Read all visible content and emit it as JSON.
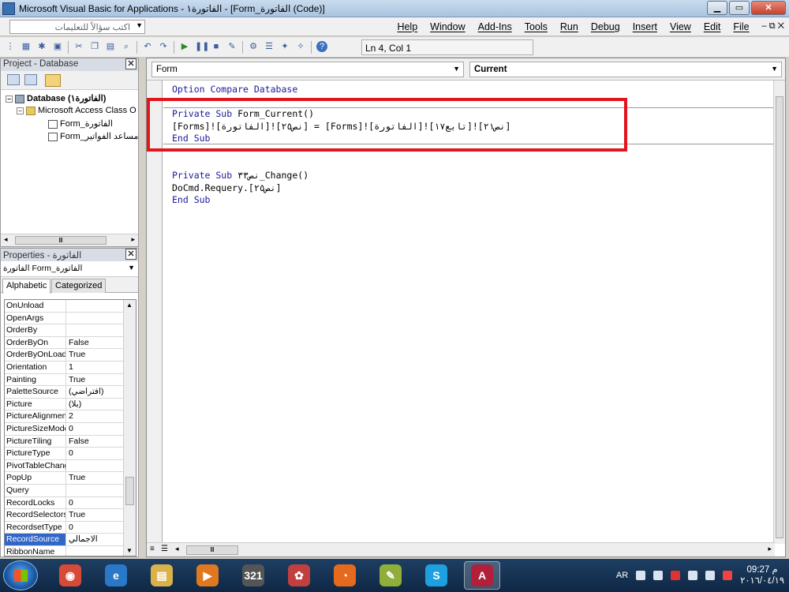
{
  "window": {
    "title": "Microsoft Visual Basic for Applications - الفاتورة١ - [Form_الفاتورة (Code)]",
    "min_label": "▁",
    "max_label": "▭",
    "close_label": "✕"
  },
  "menubar": {
    "help_placeholder": "اكتب سؤالاً للتعليمات",
    "items": [
      "Help",
      "Window",
      "Add-Ins",
      "Tools",
      "Run",
      "Debug",
      "Insert",
      "View",
      "Edit",
      "File"
    ],
    "mdi_controls": "– ⧉ ✕"
  },
  "toolbar": {
    "cursor_position": "Ln 4, Col 1"
  },
  "project_panel": {
    "title": "Project - Database",
    "close": "✕",
    "tree": {
      "root": "Database (الفاتورة١)",
      "folder": "Microsoft Access Class O",
      "items": [
        "Form_الفاتورة",
        "Form_مساعد الفواتير"
      ]
    },
    "scroll_grip": "Ⅲ"
  },
  "properties_panel": {
    "title": "Properties - الفاتورة",
    "close": "✕",
    "object_select": "الفاتورة Form_الفاتورة",
    "tabs": [
      "Alphabetic",
      "Categorized"
    ],
    "rows": [
      {
        "name": "OnUnload",
        "value": ""
      },
      {
        "name": "OpenArgs",
        "value": ""
      },
      {
        "name": "OrderBy",
        "value": ""
      },
      {
        "name": "OrderByOn",
        "value": "False"
      },
      {
        "name": "OrderByOnLoad",
        "value": "True"
      },
      {
        "name": "Orientation",
        "value": "1"
      },
      {
        "name": "Painting",
        "value": "True"
      },
      {
        "name": "PaletteSource",
        "value": "(افتراضي)"
      },
      {
        "name": "Picture",
        "value": "(بلا)"
      },
      {
        "name": "PictureAlignment",
        "value": "2"
      },
      {
        "name": "PictureSizeMode",
        "value": "0"
      },
      {
        "name": "PictureTiling",
        "value": "False"
      },
      {
        "name": "PictureType",
        "value": "0"
      },
      {
        "name": "PivotTableChange",
        "value": ""
      },
      {
        "name": "PopUp",
        "value": "True"
      },
      {
        "name": "Query",
        "value": ""
      },
      {
        "name": "RecordLocks",
        "value": "0"
      },
      {
        "name": "RecordSelectors",
        "value": "True"
      },
      {
        "name": "RecordsetType",
        "value": "0"
      },
      {
        "name": "RecordSource",
        "value": "الاجمالي"
      },
      {
        "name": "RibbonName",
        "value": ""
      }
    ],
    "selected_row": "RecordSource"
  },
  "code_window": {
    "object_combo": "Form",
    "procedure_combo": "Current",
    "lines": [
      {
        "kw1": "Option Compare Database",
        "rest": ""
      },
      {
        "kw1": "",
        "rest": ""
      },
      {
        "kw1": "Private Sub ",
        "rest": "Form_Current()"
      },
      {
        "kw1": "",
        "rest": "[Forms]![الفاتورة]![نص٢٥] = [Forms]![الفاتورة]![تابع١٧]![نص٢١]"
      },
      {
        "kw1": "End Sub",
        "rest": ""
      },
      {
        "kw1": "",
        "rest": ""
      },
      {
        "kw1": "",
        "rest": ""
      },
      {
        "kw1": "Private Sub ",
        "rest": "نص٣٣_Change()"
      },
      {
        "kw1": "",
        "rest": "DoCmd.Requery.[نص٢٥]"
      },
      {
        "kw1": "End Sub",
        "rest": ""
      }
    ],
    "hscroll_grip": "Ⅲ"
  },
  "taskbar": {
    "language": "AR",
    "time": "09:27 م",
    "date": "٢٠١٦/٠٤/١٩",
    "apps": [
      {
        "icon": "chrome-icon",
        "glyph": "◉",
        "color": "#d84a38"
      },
      {
        "icon": "internet-explorer-icon",
        "glyph": "e",
        "color": "#2a78c8"
      },
      {
        "icon": "file-explorer-icon",
        "glyph": "▤",
        "color": "#d9b24a"
      },
      {
        "icon": "media-player-icon",
        "glyph": "▶",
        "color": "#e07820"
      },
      {
        "icon": "media-player-classic-icon",
        "glyph": "321",
        "color": "#555555"
      },
      {
        "icon": "paint-app-icon",
        "glyph": "✿",
        "color": "#c04040"
      },
      {
        "icon": "firefox-icon",
        "glyph": "◔",
        "color": "#e66a1e"
      },
      {
        "icon": "notes-app-icon",
        "glyph": "✎",
        "color": "#8fae3a"
      },
      {
        "icon": "skype-icon",
        "glyph": "S",
        "color": "#1ea0e0"
      },
      {
        "icon": "access-app-icon",
        "glyph": "A",
        "color": "#b0203a"
      }
    ]
  }
}
